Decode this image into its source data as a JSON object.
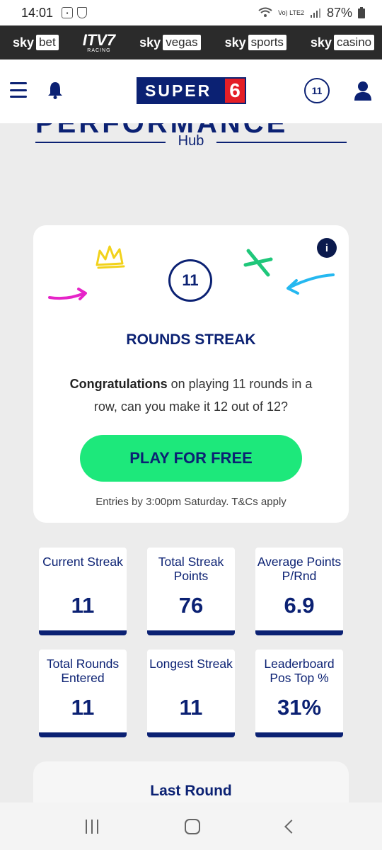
{
  "status_bar": {
    "time": "14:01",
    "network": "Vo) LTE2",
    "battery": "87%"
  },
  "brands": [
    {
      "pre": "sky",
      "box": "bet"
    },
    {
      "pre": "ITV7",
      "box": "RACING"
    },
    {
      "pre": "sky",
      "box": "vegas"
    },
    {
      "pre": "sky",
      "box": "sports"
    },
    {
      "pre": "sky",
      "box": "casino"
    }
  ],
  "header": {
    "logo_text": "SUPER",
    "logo_six": "6",
    "streak_badge": "11"
  },
  "hub": {
    "title": "PERFORMANCE",
    "subtitle": "Hub"
  },
  "streak_card": {
    "info_label": "i",
    "streak_number": "11",
    "title": "ROUNDS STREAK",
    "body_bold": "Congratulations",
    "body_rest": "on playing 11 rounds in a row, can you make it 12 out of 12?",
    "cta_label": "PLAY FOR FREE",
    "fine_print": "Entries by 3:00pm Saturday. T&Cs apply"
  },
  "stats": [
    {
      "label": "Current Streak",
      "value": "11"
    },
    {
      "label": "Total Streak Points",
      "value": "76"
    },
    {
      "label": "Average Points P/Rnd",
      "value": "6.9"
    },
    {
      "label": "Total Rounds Entered",
      "value": "11"
    },
    {
      "label": "Longest Streak",
      "value": "11"
    },
    {
      "label": "Leaderboard Pos Top %",
      "value": "31%"
    }
  ],
  "last_round": {
    "title": "Last Round"
  },
  "colors": {
    "navy": "#0b2173",
    "cta_green": "#1de87b",
    "logo_red": "#e41e26",
    "page_bg": "#ececec"
  }
}
